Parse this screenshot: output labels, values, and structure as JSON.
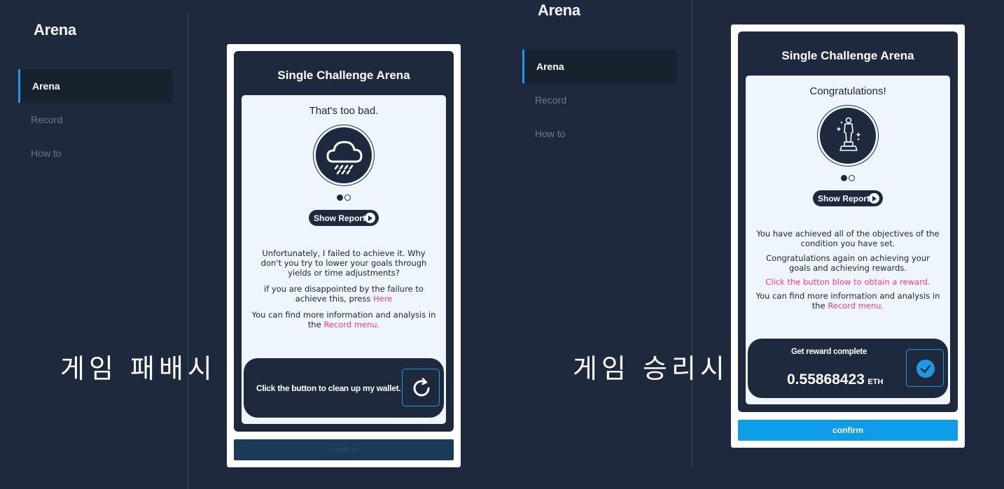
{
  "left": {
    "brand": "Arena",
    "nav": [
      "Arena",
      "Record",
      "How to"
    ],
    "caption": "게임 패배시",
    "card": {
      "title": "Single Challenge Arena",
      "status": "That's too bad.",
      "icon": "rain-cloud-icon",
      "report_label": "Show Report",
      "msg_1": "Unfortunately, I failed to achieve it. Why don't you try to lower your goals through yields or time adjustments?",
      "msg_2_prefix": "if you are disappointed by the failure to achieve this, press",
      "msg_2_link": "Here",
      "msg_3_prefix": "You can find more information and analysis in the",
      "msg_3_link": "Record menu.",
      "action_text": "Click the button to clean up my wallet.",
      "confirm_label": "confirm"
    }
  },
  "right": {
    "brand": "Arena",
    "nav": [
      "Arena",
      "Record",
      "How to"
    ],
    "caption": "게임 승리시",
    "card": {
      "title": "Single Challenge Arena",
      "status": "Congratulations!",
      "icon": "trophy-statue-icon",
      "report_label": "Show Report",
      "msg_1": "You have achieved all of the objectives of the condition you have set.",
      "msg_2": "Congratulations again on achieving your goals and achieving rewards.",
      "msg_3": "Click the button blow to obtain a reward.",
      "msg_4_prefix": "You can find more information and analysis in the",
      "msg_4_link": "Record menu.",
      "reward_label": "Get reward complete",
      "reward_amount": "0.55868423",
      "reward_unit": "ETH",
      "confirm_label": "confirm"
    }
  },
  "colors": {
    "background": "#1e293d",
    "accent": "#1e9be0",
    "link_pink": "#ee3b8a",
    "confirm_active": "#0e9de6",
    "confirm_disabled": "#1b3a57"
  }
}
